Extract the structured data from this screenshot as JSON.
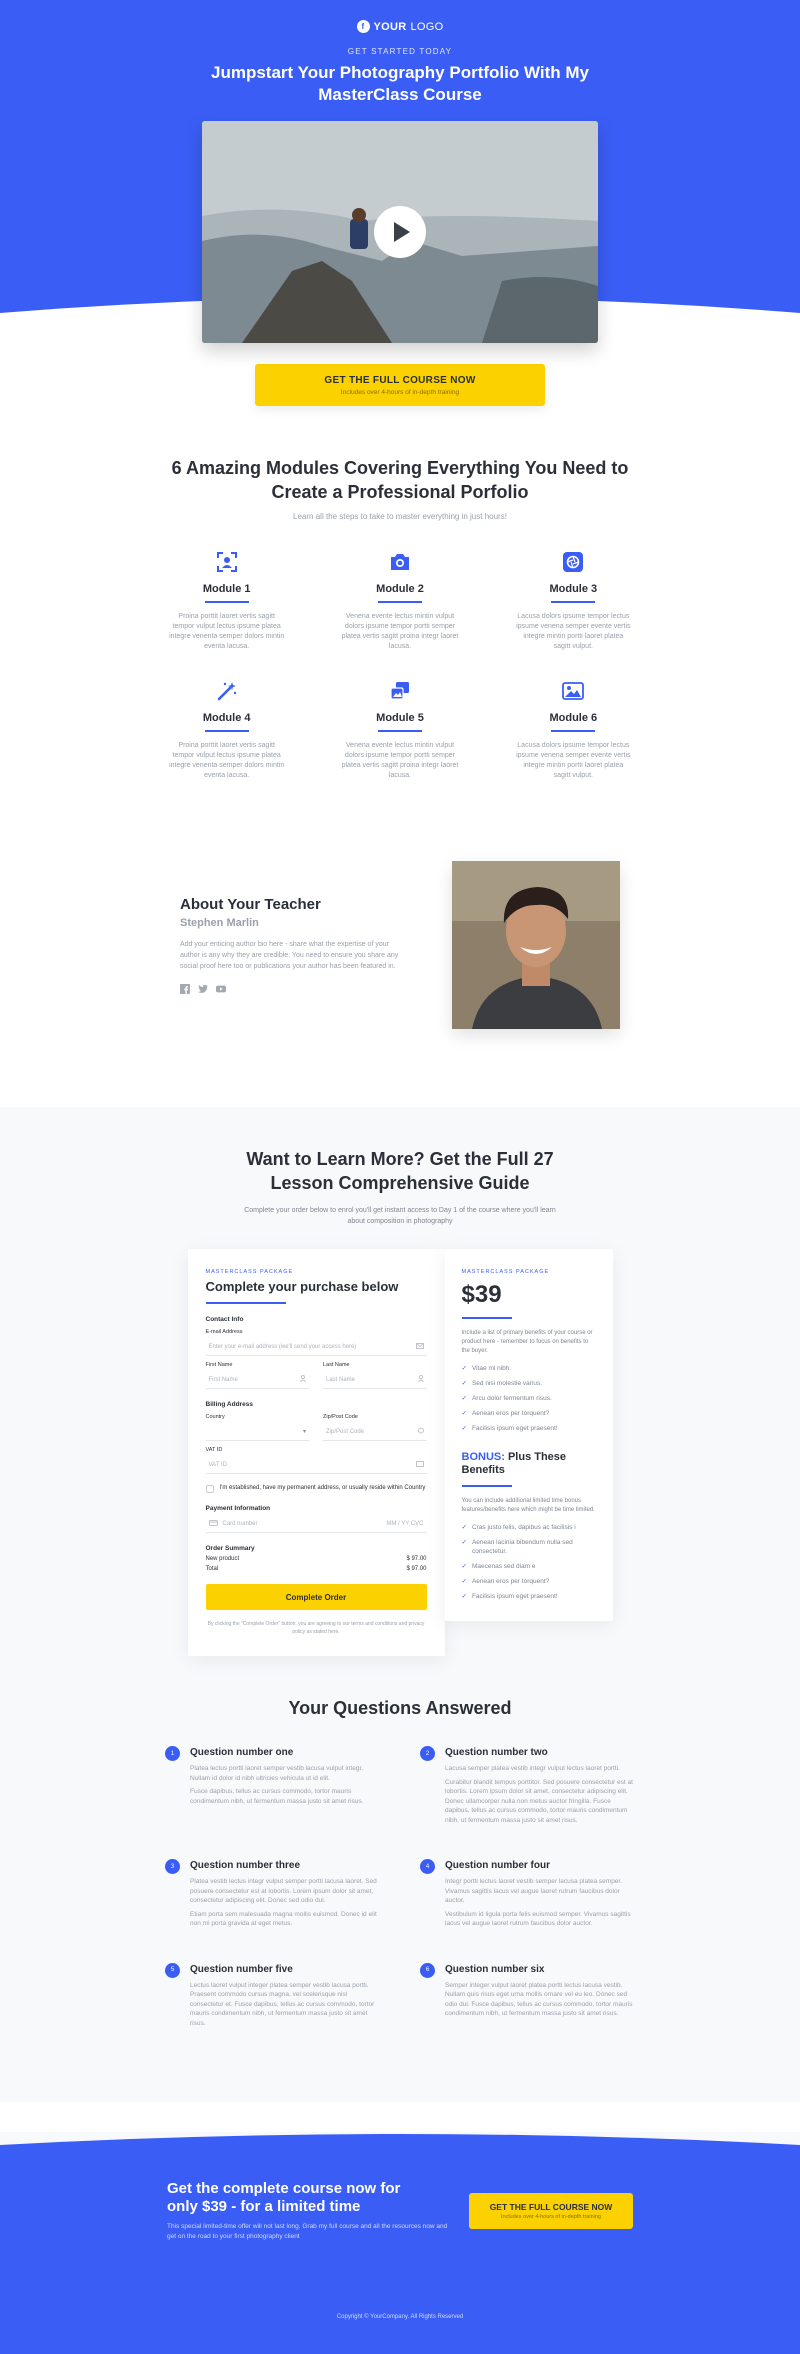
{
  "brand": {
    "logo_bold": "YOUR",
    "logo_light": "LOGO",
    "logo_mark": "f"
  },
  "hero": {
    "eyebrow": "GET STARTED TODAY",
    "title": "Jumpstart Your Photography Portfolio With My MasterClass Course"
  },
  "cta": {
    "title": "GET THE FULL COURSE NOW",
    "subtitle": "Includes over 4-hours of in-depth training"
  },
  "modules": {
    "title": "6 Amazing Modules Covering Everything You Need to Create a Professional Porfolio",
    "subtitle": "Learn all the steps to take to master everything in just hours!",
    "items": [
      {
        "title": "Module 1",
        "icon": "portrait-scan-icon",
        "text": "Proina porttit laoret vertis sagitt tempor vulput lectus ipsume platea integre venenta semper dolors mintin eventa lacusa."
      },
      {
        "title": "Module 2",
        "icon": "camera-icon",
        "text": "Venena evente lectus mintin vulput dolors ipsume tempor portti semper platea vertis sagitt proina integr laoret lacusa."
      },
      {
        "title": "Module 3",
        "icon": "aperture-icon",
        "text": "Lacusa dolors ipsume tempor lectus ipsume venena semper evente vertis integre mintin portti laoret platea sagitt vulput."
      },
      {
        "title": "Module 4",
        "icon": "magic-wand-icon",
        "text": "Proina porttit laoret vertis sagitt tempor vulput lectus ipsume platea integre venenta semper dolors mintin eventa lacusa."
      },
      {
        "title": "Module 5",
        "icon": "photo-stack-icon",
        "text": "Venena evente lectus mintin vulput dolors ipsume tempor portti semper platea vertis sagitt proina integr laoret lacusa."
      },
      {
        "title": "Module 6",
        "icon": "image-frame-icon",
        "text": "Lacusa dolors ipsume tempor lectus ipsume venena semper evente vertis integre mintin portti laoret platea sagitt vulput."
      }
    ]
  },
  "teacher": {
    "heading": "About Your Teacher",
    "name": "Stephen Marlin",
    "bio": "Add your enticing author bio here - share what the expertise of your author is any why they are credible. You need to ensure you share any social proof here too or publications your author has been featured in.",
    "social": [
      "facebook-icon",
      "twitter-icon",
      "youtube-icon"
    ]
  },
  "purchase": {
    "title": "Want to Learn More? Get the Full 27 Lesson Comprehensive Guide",
    "subtitle": "Complete your order below to enrol you'll get instant access to Day 1 of the course where you'll learn about composition in photography",
    "form": {
      "tag": "MASTERCLASS PACKAGE",
      "title": "Complete your purchase below",
      "contact_heading": "Contact Info",
      "email_label": "E-mail Address",
      "email_placeholder": "Enter your e-mail address (we'll send your access here)",
      "first_label": "First Name",
      "first_placeholder": "First Name",
      "last_label": "Last Name",
      "last_placeholder": "Last Name",
      "billing_heading": "Billing Address",
      "country_label": "Country",
      "zip_label": "Zip/Post Code",
      "zip_placeholder": "Zip/Post Code",
      "vat_label": "VAT ID",
      "vat_placeholder": "VAT ID",
      "established_label": "I'm established, have my permanent address, or usually reside within Country",
      "payment_heading": "Payment Information",
      "card_placeholder": "Card number",
      "card_exp": "MM / YY  CVC",
      "summary_heading": "Order Summary",
      "product_label": "New product",
      "product_price": "$ 97.00",
      "total_label": "Total",
      "total_price": "$ 97.00",
      "button": "Complete Order",
      "terms": "By clicking the \"Complete Order\" button, you are agreeing to our terms and conditions and privacy policy as stated here."
    },
    "side": {
      "tag": "MASTERCLASS PACKAGE",
      "price": "$39",
      "text": "Include a list of primary benefits of your course or product here - remember to focus on benefits to the buyer.",
      "benefits": [
        "Vitae mi nibh.",
        "Sed nisi molestie varius.",
        "Arcu dolor fermentum risus.",
        "Aenean eros per torquent?",
        "Facilisis ipsum eget praesent!"
      ],
      "bonus_label": "BONUS:",
      "bonus_title": "Plus These Benefits",
      "bonus_text": "You can include additional limited time bonus features/benefits here which might be time limited.",
      "bonus_items": [
        "Cras justo felis, dapibus ac facilisis i",
        "Aenean lacinia bibendum nulla sed consectetur.",
        "Maecenas sed diam e",
        "Aenean eros per torquent?",
        "Facilisis ipsum eget praesent!"
      ]
    }
  },
  "faq": {
    "title": "Your Questions Answered",
    "items": [
      {
        "n": "1",
        "q": "Question number one",
        "a": [
          "Platea lectus portti laoret semper vestib lacusa vulput integr. Nullam id dolor id nibh ultricies vehicula ut id elit.",
          "Fusce dapibus, tellus ac cursus commodo, tortor mauris condimentum nibh, ut fermentum massa justo sit amet risus."
        ]
      },
      {
        "n": "2",
        "q": "Question number two",
        "a": [
          "Lacusa semper platea vestib integr vulput lectus laoret portti.",
          "Curabitur blandit tempus porttitor. Sed posuere consectetur est at lobortis. Lorem ipsum dolor sit amet, consectetur adipiscing elit. Donec ullamcorper nulla non metus auctor fringilla. Fusce dapibus, tellus ac cursus commodo, tortor mauris condimentum nibh, ut fermentum massa justo sit amet risus."
        ]
      },
      {
        "n": "3",
        "q": "Question number three",
        "a": [
          "Platea vestib lectus integr vulput semper portti lacusa laoret. Sed posuere consectetur est at lobortis. Lorem ipsum dolor sit amet, consectetur adipiscing elit. Donec sed odio dui.",
          "Etiam porta sem malesuada magna mollis euismod. Donec id elit non mi porta gravida at eget metus."
        ]
      },
      {
        "n": "4",
        "q": "Question number four",
        "a": [
          "Integr portti lectus laoret vestib semper lacusa platea semper. Vivamus sagittis lacus vel augue laoret rutrum faucibus dolor auctor.",
          "Vestibulum id ligula porta felis euismod semper. Vivamus sagittis lacus vel augue laoret rutrum faucibus dolor auctor."
        ]
      },
      {
        "n": "5",
        "q": "Question number five",
        "a": [
          "Lectus laoret vulput integer platea semper vestib lacusa portti. Praesent commodo cursus magna, vel scelerisque nisl consectetur et. Fusce dapibus, tellus ac cursus commodo, tortor mauris condimentum nibh, ut fermentum massa justo sit amet risus."
        ]
      },
      {
        "n": "6",
        "q": "Question number six",
        "a": [
          "Semper integer vulput laoret platea portti lectus lacusa vestib. Nullam quis risus eget urna mollis ornare vel eu leo. Donec sed odio dui. Fusce dapibus, tellus ac cursus commodo, tortor mauris condimentum nibh, ut fermentum massa justo sit amet risus."
        ]
      }
    ]
  },
  "footer": {
    "title": "Get the complete course now for only $39 - for a limited time",
    "text": "This special limited-time offer will not last long. Grab my full course and all the resources now and get on the road to your first photography client",
    "cta_title": "GET THE FULL COURSE NOW",
    "cta_subtitle": "Includes over 4-hours of in-depth training",
    "copyright": "Copyright © YourCompany. All Rights Reserved"
  },
  "colors": {
    "primary": "#3a5ef5",
    "accent": "#fbd100",
    "text": "#2b2f38",
    "muted": "#9aa1ab"
  }
}
